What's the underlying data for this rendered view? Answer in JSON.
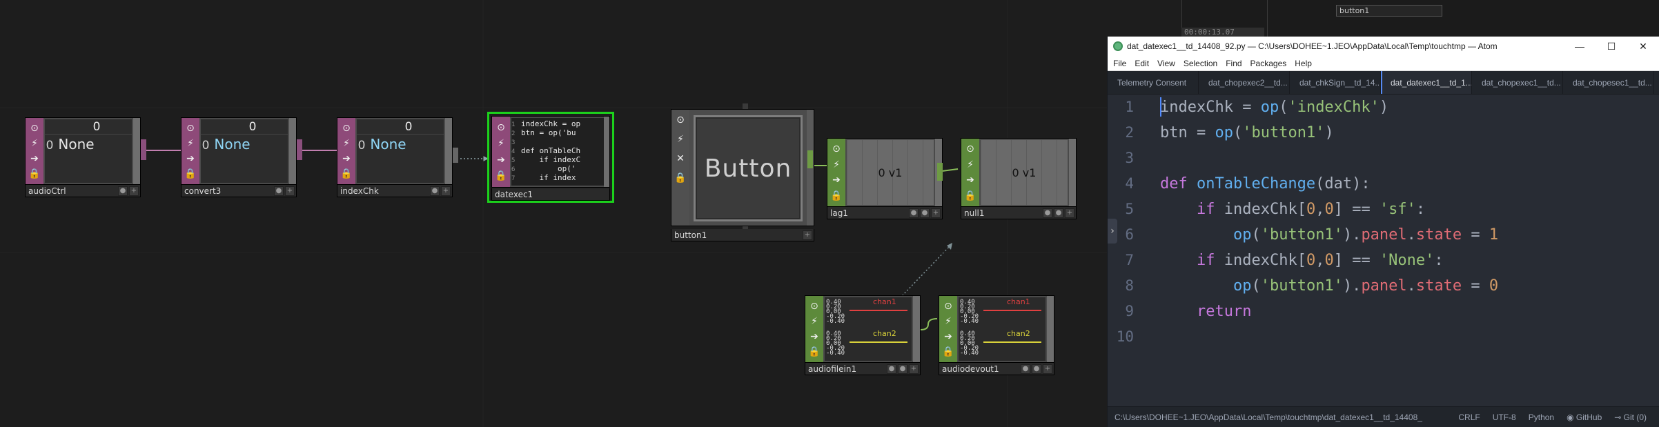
{
  "nodes": {
    "audioCtrl": {
      "name": "audioCtrl",
      "header": "0",
      "row_index": "0",
      "row_value": "None"
    },
    "convert3": {
      "name": "convert3",
      "header": "0",
      "row_index": "0",
      "row_value": "None"
    },
    "indexChk": {
      "name": "indexChk",
      "header": "0",
      "row_index": "0",
      "row_value": "None"
    },
    "datexec1": {
      "name": "datexec1",
      "code_preview": [
        {
          "n": "1",
          "t": "indexChk = op"
        },
        {
          "n": "2",
          "t": "btn = op('bu"
        },
        {
          "n": "3",
          "t": ""
        },
        {
          "n": "4",
          "t": "def onTableCh"
        },
        {
          "n": "5",
          "t": "    if indexC"
        },
        {
          "n": "6",
          "t": "        op('"
        },
        {
          "n": "7",
          "t": "    if index"
        }
      ]
    },
    "button1": {
      "name": "button1",
      "label": "Button"
    },
    "lag1": {
      "name": "lag1",
      "value": "0  v1"
    },
    "null1": {
      "name": "null1",
      "value": "0  v1"
    },
    "audiofilein1": {
      "name": "audiofilein1",
      "ch1": "chan1",
      "ch2": "chan2",
      "ticks": [
        "0.40",
        "0.20",
        "0.00",
        "-0.20",
        "-0.40"
      ]
    },
    "audiodevout1": {
      "name": "audiodevout1",
      "ch1": "chan1",
      "ch2": "chan2",
      "ticks": [
        "0.40",
        "0.20",
        "0.00",
        "-0.20",
        "-0.40"
      ]
    }
  },
  "timeline": {
    "time": "00:00:13.07",
    "button_label": "button1"
  },
  "atom": {
    "title": "dat_datexec1__td_14408_92.py — C:\\Users\\DOHEE~1.JEO\\AppData\\Local\\Temp\\touchtmp — Atom",
    "menu": [
      "File",
      "Edit",
      "View",
      "Selection",
      "Find",
      "Packages",
      "Help"
    ],
    "tabs": [
      "Telemetry Consent",
      "dat_chopexec2__td...",
      "dat_chkSign__td_14...",
      "dat_datexec1__td_1...",
      "dat_chopexec1__td...",
      "dat_chopesec1__td..."
    ],
    "active_tab_index": 3,
    "line_numbers": [
      "1",
      "2",
      "3",
      "4",
      "5",
      "6",
      "7",
      "8",
      "9",
      "10"
    ],
    "status": {
      "path": "C:\\Users\\DOHEE~1.JEO\\AppData\\Local\\Temp\\touchtmp\\dat_datexec1__td_14408_",
      "line_ending": "CRLF",
      "encoding": "UTF-8",
      "grammar": "Python",
      "github": "GitHub",
      "git": "Git (0)"
    },
    "colors": {
      "keyword": "#c678dd",
      "function": "#61afef",
      "string": "#98c379",
      "number": "#d19a66",
      "property": "#e06c75"
    }
  },
  "window_buttons": {
    "minimize": "—",
    "maximize": "☐",
    "close": "✕"
  }
}
